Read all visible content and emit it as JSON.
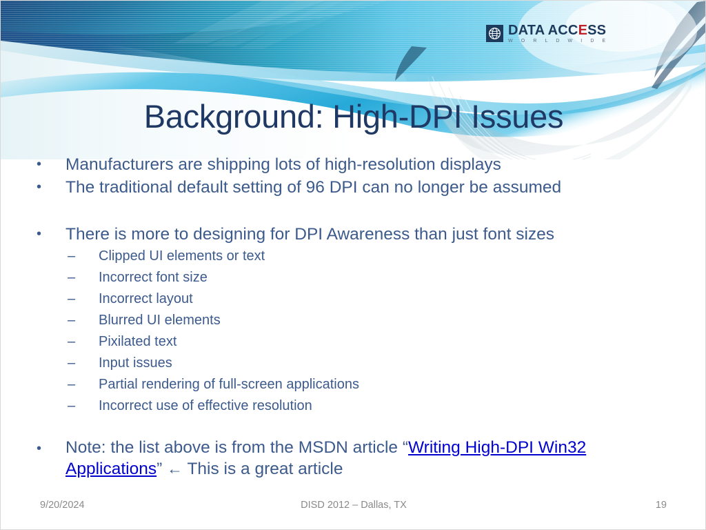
{
  "logo": {
    "name_part1": "DATA ACC",
    "name_dot": "E",
    "name_part2": "SS",
    "full_name": "DATA ACCESS",
    "tagline": "W O R L D W I D E"
  },
  "title": "Background: High-DPI Issues",
  "bullets": [
    {
      "level": 1,
      "marker": "•",
      "text": "Manufacturers are shipping lots of high-resolution displays"
    },
    {
      "level": 1,
      "marker": "•",
      "text": "The traditional default setting of 96 DPI can no longer be assumed"
    },
    {
      "level": 1,
      "marker": "•",
      "text": "There is more to designing for DPI Awareness than just font sizes"
    },
    {
      "level": 2,
      "marker": "–",
      "text": "Clipped UI elements or text"
    },
    {
      "level": 2,
      "marker": "–",
      "text": "Incorrect font size"
    },
    {
      "level": 2,
      "marker": "–",
      "text": "Incorrect layout"
    },
    {
      "level": 2,
      "marker": "–",
      "text": "Blurred UI elements"
    },
    {
      "level": 2,
      "marker": "–",
      "text": "Pixilated text"
    },
    {
      "level": 2,
      "marker": "–",
      "text": "Input issues"
    },
    {
      "level": 2,
      "marker": "–",
      "text": "Partial rendering of full-screen applications"
    },
    {
      "level": 2,
      "marker": "–",
      "text": "Incorrect use of effective resolution"
    }
  ],
  "note": {
    "marker": "•",
    "lead": "Note: the list above is from the MSDN article “",
    "link_text": "Writing High-DPI Win32 Applications",
    "after_link": "” ",
    "arrow": "←",
    "tail": " This is a great article"
  },
  "footer": {
    "date": "9/20/2024",
    "center": "DISD 2012 – Dallas, TX",
    "slide_number": "19"
  },
  "colors": {
    "title": "#1f3864",
    "body_text": "#3c5a8c",
    "link": "#0000cf",
    "footer_text": "#8a8a8a",
    "banner_navy": "#1f5a96",
    "banner_teal": "#1a8ba8",
    "banner_cyan": "#53c3e8",
    "logo_navy": "#1b3a5c",
    "logo_accent_red": "#c0202a"
  }
}
